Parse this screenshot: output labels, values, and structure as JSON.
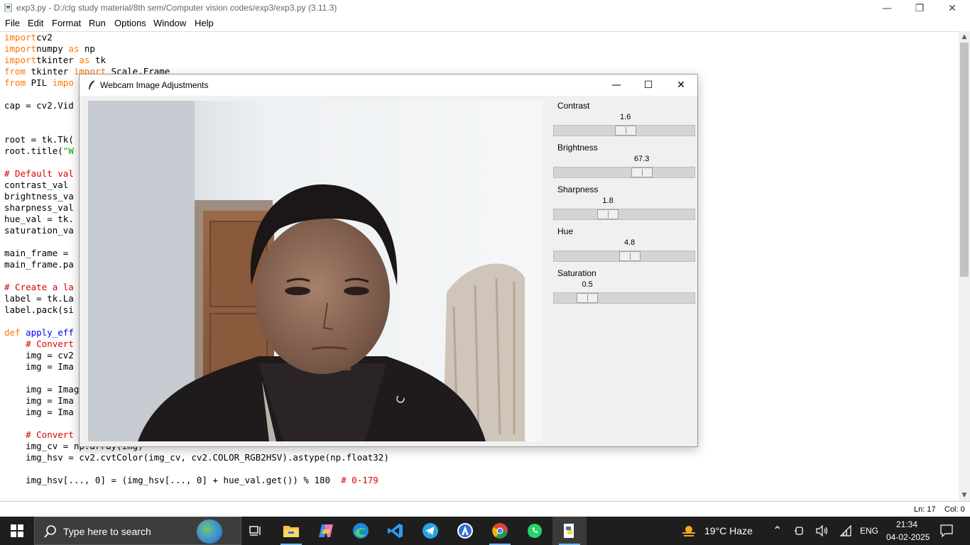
{
  "idle": {
    "window_title": "exp3.py - D:/clg study material/8th sem/Computer vision codes/exp3/exp3.py (3.11.3)",
    "menu": [
      "File",
      "Edit",
      "Format",
      "Run",
      "Options",
      "Window",
      "Help"
    ],
    "status": {
      "line": "Ln: 17",
      "col": "Col: 0"
    }
  },
  "code": [
    [
      [
        "kw",
        "import"
      ],
      [
        "",
        "cv2"
      ]
    ],
    [
      [
        "kw",
        "import"
      ],
      [
        "",
        "numpy "
      ],
      [
        "kw",
        "as"
      ],
      [
        "",
        " np"
      ]
    ],
    [
      [
        "kw",
        "import"
      ],
      [
        "",
        "tkinter "
      ],
      [
        "kw",
        "as"
      ],
      [
        "",
        " tk"
      ]
    ],
    [
      [
        "kw",
        "from"
      ],
      [
        "",
        " tkinter "
      ],
      [
        "kw",
        "import"
      ],
      [
        "",
        " Scale,Frame"
      ]
    ],
    [
      [
        "kw",
        "from"
      ],
      [
        "",
        " PIL "
      ],
      [
        "kw",
        "impo"
      ]
    ],
    [
      [
        "",
        ""
      ]
    ],
    [
      [
        "",
        "cap = cv2.Vid"
      ]
    ],
    [
      [
        "",
        ""
      ]
    ],
    [
      [
        "",
        ""
      ]
    ],
    [
      [
        "",
        "root = tk.Tk("
      ]
    ],
    [
      [
        "",
        "root.title("
      ],
      [
        "st",
        "\"W"
      ]
    ],
    [
      [
        "",
        ""
      ]
    ],
    [
      [
        "cm",
        "# Default val"
      ]
    ],
    [
      [
        "",
        "contrast_val "
      ]
    ],
    [
      [
        "",
        "brightness_va"
      ]
    ],
    [
      [
        "",
        "sharpness_val"
      ]
    ],
    [
      [
        "",
        "hue_val = tk."
      ]
    ],
    [
      [
        "",
        "saturation_va"
      ]
    ],
    [
      [
        "",
        ""
      ]
    ],
    [
      [
        "",
        "main_frame = "
      ]
    ],
    [
      [
        "",
        "main_frame.pa"
      ]
    ],
    [
      [
        "",
        ""
      ]
    ],
    [
      [
        "cm",
        "# Create a la"
      ]
    ],
    [
      [
        "",
        "label = tk.La"
      ]
    ],
    [
      [
        "",
        "label.pack(si"
      ]
    ],
    [
      [
        "",
        ""
      ]
    ],
    [
      [
        "kw",
        "def"
      ],
      [
        "",
        " "
      ],
      [
        "fn",
        "apply_eff"
      ]
    ],
    [
      [
        "",
        "    "
      ],
      [
        "cm",
        "# Convert"
      ]
    ],
    [
      [
        "",
        "    img = cv2"
      ]
    ],
    [
      [
        "",
        "    img = Ima"
      ]
    ],
    [
      [
        "",
        ""
      ]
    ],
    [
      [
        "",
        "    img = Imag"
      ]
    ],
    [
      [
        "",
        "    img = Ima"
      ]
    ],
    [
      [
        "",
        "    img = Ima"
      ]
    ],
    [
      [
        "",
        ""
      ]
    ],
    [
      [
        "",
        "    "
      ],
      [
        "cm",
        "# Convert"
      ]
    ],
    [
      [
        "",
        "    img_cv = np.array(img)"
      ]
    ],
    [
      [
        "",
        "    img_hsv = cv2.cvtColor(img_cv, cv2.COLOR_RGB2HSV).astype(np.float32)"
      ]
    ],
    [
      [
        "",
        ""
      ]
    ],
    [
      [
        "",
        "    img_hsv[..., 0] = (img_hsv[..., 0] + hue_val.get()) % 180  "
      ],
      [
        "cm",
        "# 0-179"
      ]
    ]
  ],
  "tk": {
    "window_title": "Webcam Image Adjustments",
    "sliders": [
      {
        "label": "Contrast",
        "value": "1.6",
        "fraction": 0.51
      },
      {
        "label": "Brightness",
        "value": "67.3",
        "fraction": 0.645
      },
      {
        "label": "Sharpness",
        "value": "1.8",
        "fraction": 0.365
      },
      {
        "label": "Hue",
        "value": "4.8",
        "fraction": 0.545
      },
      {
        "label": "Saturation",
        "value": "0.5",
        "fraction": 0.195
      }
    ]
  },
  "taskbar": {
    "search_placeholder": "Type here to search",
    "weather": "19°C  Haze",
    "language": "ENG",
    "time": "21:34",
    "date": "04-02-2025"
  },
  "icons": {
    "start": "windows-start-icon",
    "search": "search-icon",
    "task_view": "task-view-icon",
    "apps": [
      "file-explorer-icon",
      "copilot-icon",
      "edge-icon",
      "vscode-icon",
      "telegram-icon",
      "store-app-icon",
      "chrome-icon",
      "whatsapp-icon",
      "python-idle-icon"
    ]
  }
}
